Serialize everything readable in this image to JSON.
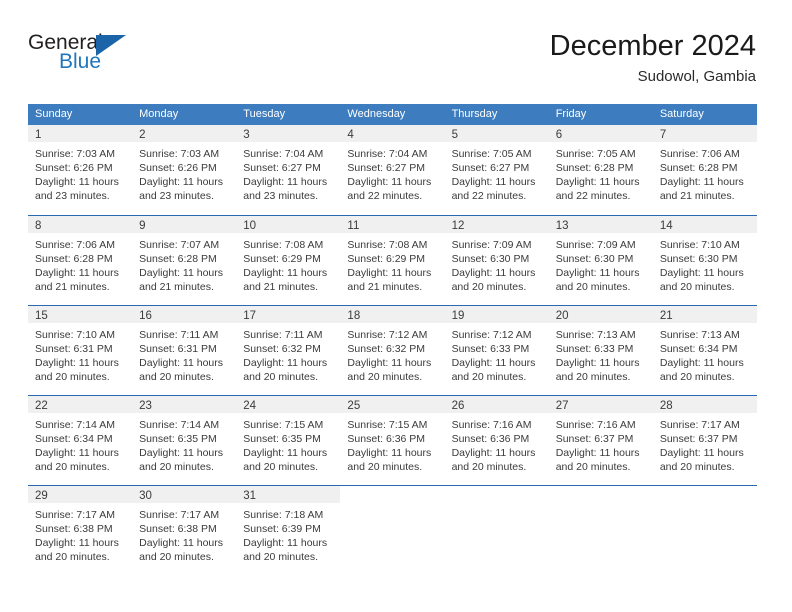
{
  "brand": {
    "name_part1": "General",
    "name_part2": "Blue",
    "triangle_icon": "triangle-icon",
    "accent_color": "#1f76bc"
  },
  "header": {
    "title": "December 2024",
    "location": "Sudowol, Gambia"
  },
  "theme": {
    "header_blue": "#3c7cbf",
    "row_border_blue": "#2a6ab0",
    "day_band_gray": "#f0f0f0",
    "text_color": "#3b3b3b"
  },
  "calendar": {
    "weekday_headers": [
      "Sunday",
      "Monday",
      "Tuesday",
      "Wednesday",
      "Thursday",
      "Friday",
      "Saturday"
    ],
    "weeks": [
      [
        {
          "day": "1",
          "sunrise": "Sunrise: 7:03 AM",
          "sunset": "Sunset: 6:26 PM",
          "daylight_line1": "Daylight: 11 hours",
          "daylight_line2": "and 23 minutes."
        },
        {
          "day": "2",
          "sunrise": "Sunrise: 7:03 AM",
          "sunset": "Sunset: 6:26 PM",
          "daylight_line1": "Daylight: 11 hours",
          "daylight_line2": "and 23 minutes."
        },
        {
          "day": "3",
          "sunrise": "Sunrise: 7:04 AM",
          "sunset": "Sunset: 6:27 PM",
          "daylight_line1": "Daylight: 11 hours",
          "daylight_line2": "and 23 minutes."
        },
        {
          "day": "4",
          "sunrise": "Sunrise: 7:04 AM",
          "sunset": "Sunset: 6:27 PM",
          "daylight_line1": "Daylight: 11 hours",
          "daylight_line2": "and 22 minutes."
        },
        {
          "day": "5",
          "sunrise": "Sunrise: 7:05 AM",
          "sunset": "Sunset: 6:27 PM",
          "daylight_line1": "Daylight: 11 hours",
          "daylight_line2": "and 22 minutes."
        },
        {
          "day": "6",
          "sunrise": "Sunrise: 7:05 AM",
          "sunset": "Sunset: 6:28 PM",
          "daylight_line1": "Daylight: 11 hours",
          "daylight_line2": "and 22 minutes."
        },
        {
          "day": "7",
          "sunrise": "Sunrise: 7:06 AM",
          "sunset": "Sunset: 6:28 PM",
          "daylight_line1": "Daylight: 11 hours",
          "daylight_line2": "and 21 minutes."
        }
      ],
      [
        {
          "day": "8",
          "sunrise": "Sunrise: 7:06 AM",
          "sunset": "Sunset: 6:28 PM",
          "daylight_line1": "Daylight: 11 hours",
          "daylight_line2": "and 21 minutes."
        },
        {
          "day": "9",
          "sunrise": "Sunrise: 7:07 AM",
          "sunset": "Sunset: 6:28 PM",
          "daylight_line1": "Daylight: 11 hours",
          "daylight_line2": "and 21 minutes."
        },
        {
          "day": "10",
          "sunrise": "Sunrise: 7:08 AM",
          "sunset": "Sunset: 6:29 PM",
          "daylight_line1": "Daylight: 11 hours",
          "daylight_line2": "and 21 minutes."
        },
        {
          "day": "11",
          "sunrise": "Sunrise: 7:08 AM",
          "sunset": "Sunset: 6:29 PM",
          "daylight_line1": "Daylight: 11 hours",
          "daylight_line2": "and 21 minutes."
        },
        {
          "day": "12",
          "sunrise": "Sunrise: 7:09 AM",
          "sunset": "Sunset: 6:30 PM",
          "daylight_line1": "Daylight: 11 hours",
          "daylight_line2": "and 20 minutes."
        },
        {
          "day": "13",
          "sunrise": "Sunrise: 7:09 AM",
          "sunset": "Sunset: 6:30 PM",
          "daylight_line1": "Daylight: 11 hours",
          "daylight_line2": "and 20 minutes."
        },
        {
          "day": "14",
          "sunrise": "Sunrise: 7:10 AM",
          "sunset": "Sunset: 6:30 PM",
          "daylight_line1": "Daylight: 11 hours",
          "daylight_line2": "and 20 minutes."
        }
      ],
      [
        {
          "day": "15",
          "sunrise": "Sunrise: 7:10 AM",
          "sunset": "Sunset: 6:31 PM",
          "daylight_line1": "Daylight: 11 hours",
          "daylight_line2": "and 20 minutes."
        },
        {
          "day": "16",
          "sunrise": "Sunrise: 7:11 AM",
          "sunset": "Sunset: 6:31 PM",
          "daylight_line1": "Daylight: 11 hours",
          "daylight_line2": "and 20 minutes."
        },
        {
          "day": "17",
          "sunrise": "Sunrise: 7:11 AM",
          "sunset": "Sunset: 6:32 PM",
          "daylight_line1": "Daylight: 11 hours",
          "daylight_line2": "and 20 minutes."
        },
        {
          "day": "18",
          "sunrise": "Sunrise: 7:12 AM",
          "sunset": "Sunset: 6:32 PM",
          "daylight_line1": "Daylight: 11 hours",
          "daylight_line2": "and 20 minutes."
        },
        {
          "day": "19",
          "sunrise": "Sunrise: 7:12 AM",
          "sunset": "Sunset: 6:33 PM",
          "daylight_line1": "Daylight: 11 hours",
          "daylight_line2": "and 20 minutes."
        },
        {
          "day": "20",
          "sunrise": "Sunrise: 7:13 AM",
          "sunset": "Sunset: 6:33 PM",
          "daylight_line1": "Daylight: 11 hours",
          "daylight_line2": "and 20 minutes."
        },
        {
          "day": "21",
          "sunrise": "Sunrise: 7:13 AM",
          "sunset": "Sunset: 6:34 PM",
          "daylight_line1": "Daylight: 11 hours",
          "daylight_line2": "and 20 minutes."
        }
      ],
      [
        {
          "day": "22",
          "sunrise": "Sunrise: 7:14 AM",
          "sunset": "Sunset: 6:34 PM",
          "daylight_line1": "Daylight: 11 hours",
          "daylight_line2": "and 20 minutes."
        },
        {
          "day": "23",
          "sunrise": "Sunrise: 7:14 AM",
          "sunset": "Sunset: 6:35 PM",
          "daylight_line1": "Daylight: 11 hours",
          "daylight_line2": "and 20 minutes."
        },
        {
          "day": "24",
          "sunrise": "Sunrise: 7:15 AM",
          "sunset": "Sunset: 6:35 PM",
          "daylight_line1": "Daylight: 11 hours",
          "daylight_line2": "and 20 minutes."
        },
        {
          "day": "25",
          "sunrise": "Sunrise: 7:15 AM",
          "sunset": "Sunset: 6:36 PM",
          "daylight_line1": "Daylight: 11 hours",
          "daylight_line2": "and 20 minutes."
        },
        {
          "day": "26",
          "sunrise": "Sunrise: 7:16 AM",
          "sunset": "Sunset: 6:36 PM",
          "daylight_line1": "Daylight: 11 hours",
          "daylight_line2": "and 20 minutes."
        },
        {
          "day": "27",
          "sunrise": "Sunrise: 7:16 AM",
          "sunset": "Sunset: 6:37 PM",
          "daylight_line1": "Daylight: 11 hours",
          "daylight_line2": "and 20 minutes."
        },
        {
          "day": "28",
          "sunrise": "Sunrise: 7:17 AM",
          "sunset": "Sunset: 6:37 PM",
          "daylight_line1": "Daylight: 11 hours",
          "daylight_line2": "and 20 minutes."
        }
      ],
      [
        {
          "day": "29",
          "sunrise": "Sunrise: 7:17 AM",
          "sunset": "Sunset: 6:38 PM",
          "daylight_line1": "Daylight: 11 hours",
          "daylight_line2": "and 20 minutes."
        },
        {
          "day": "30",
          "sunrise": "Sunrise: 7:17 AM",
          "sunset": "Sunset: 6:38 PM",
          "daylight_line1": "Daylight: 11 hours",
          "daylight_line2": "and 20 minutes."
        },
        {
          "day": "31",
          "sunrise": "Sunrise: 7:18 AM",
          "sunset": "Sunset: 6:39 PM",
          "daylight_line1": "Daylight: 11 hours",
          "daylight_line2": "and 20 minutes."
        },
        {
          "day": "",
          "sunrise": "",
          "sunset": "",
          "daylight_line1": "",
          "daylight_line2": ""
        },
        {
          "day": "",
          "sunrise": "",
          "sunset": "",
          "daylight_line1": "",
          "daylight_line2": ""
        },
        {
          "day": "",
          "sunrise": "",
          "sunset": "",
          "daylight_line1": "",
          "daylight_line2": ""
        },
        {
          "day": "",
          "sunrise": "",
          "sunset": "",
          "daylight_line1": "",
          "daylight_line2": ""
        }
      ]
    ]
  }
}
